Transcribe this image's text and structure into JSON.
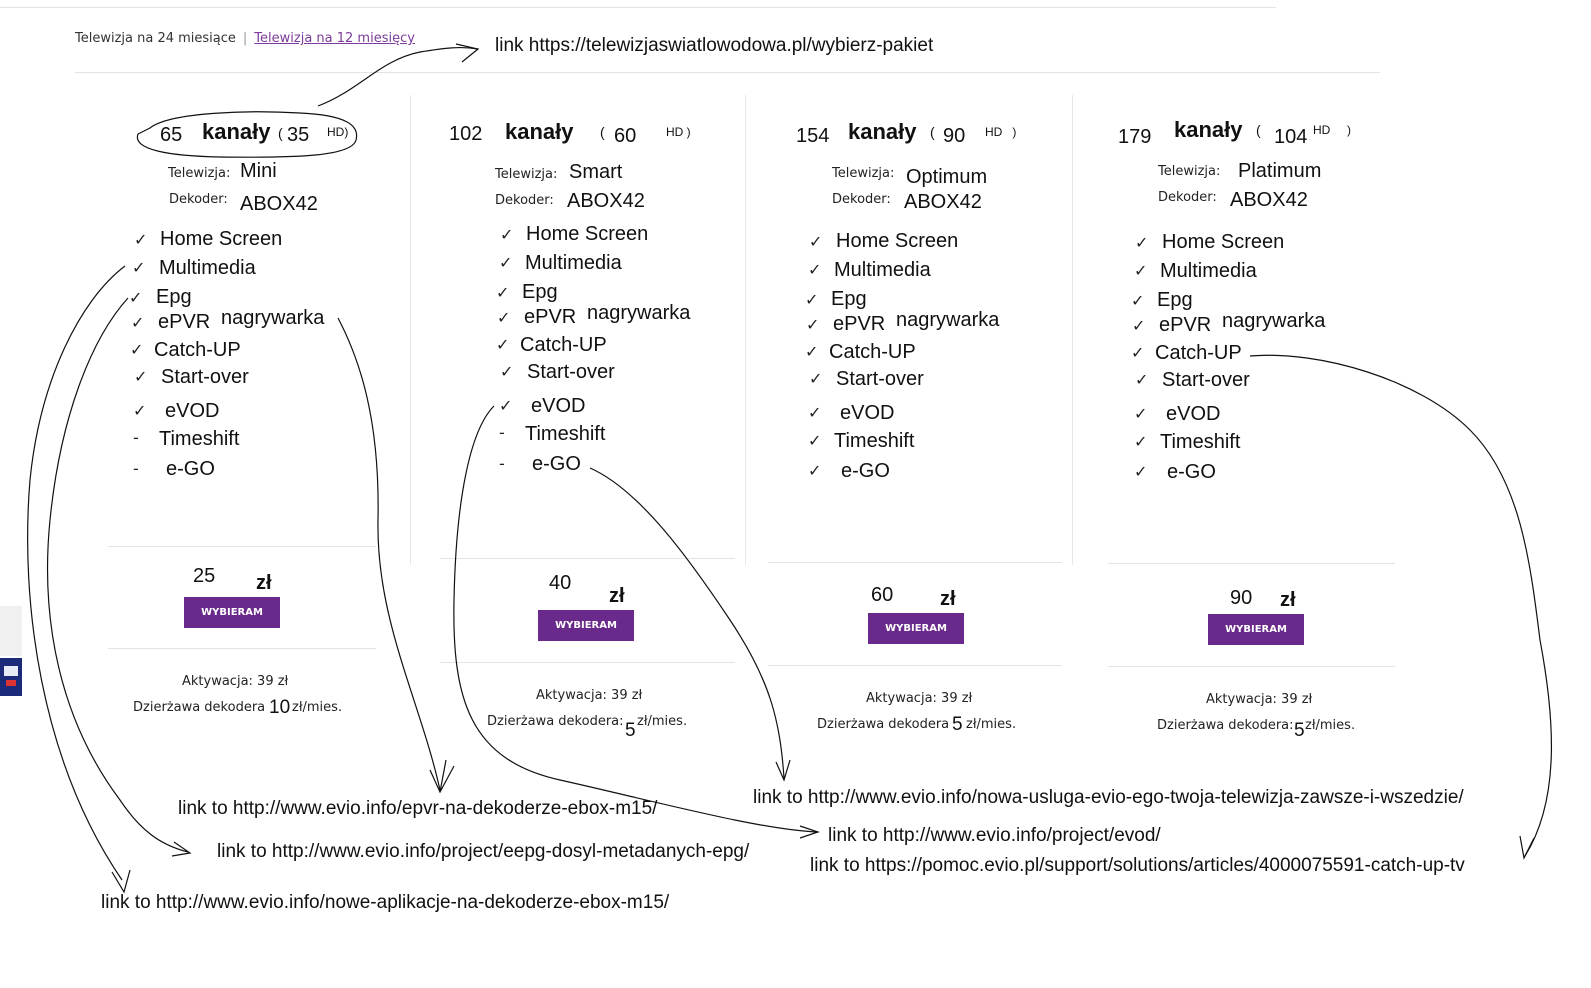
{
  "tabs": {
    "active": "Telewizja na 24 miesiące",
    "separator": "|",
    "link": "Telewizja na 12 miesięcy"
  },
  "labels": {
    "telewizja": "Telewizja:",
    "dekoder": "Dekoder:",
    "kanaly": "kanały",
    "hd": "HD)",
    "zl": "zł",
    "button": "WYBIERAM",
    "aktywacja": "Aktywacja: 39 zł",
    "dzierzawa": "Dzierżawa dekodera",
    "per_month": "zł/mies.",
    "check": "✓",
    "dash": "-"
  },
  "packages": [
    {
      "channels": "65",
      "hd": "35",
      "tv": "Mini",
      "decoder": "ABOX42",
      "price": "25",
      "rental": "10",
      "features": [
        "Home Screen",
        "Multimedia",
        "Epg",
        "ePVR",
        "Catch-UP",
        "Start-over",
        "eVOD",
        "Timeshift",
        "e-GO"
      ],
      "nagrywarka": "nagrywarka",
      "marks": [
        "check",
        "check",
        "check",
        "check",
        "check",
        "check",
        "check",
        "dash",
        "dash"
      ]
    },
    {
      "channels": "102",
      "hd": "60",
      "tv": "Smart",
      "decoder": "ABOX42",
      "price": "40",
      "rental": "5",
      "features": [
        "Home Screen",
        "Multimedia",
        "Epg",
        "ePVR",
        "Catch-UP",
        "Start-over",
        "eVOD",
        "Timeshift",
        "e-GO"
      ],
      "nagrywarka": "nagrywarka",
      "marks": [
        "check",
        "check",
        "check",
        "check",
        "check",
        "check",
        "check",
        "dash",
        "dash"
      ]
    },
    {
      "channels": "154",
      "hd": "90",
      "tv": "Optimum",
      "decoder": "ABOX42",
      "price": "60",
      "rental": "5",
      "features": [
        "Home Screen",
        "Multimedia",
        "Epg",
        "ePVR",
        "Catch-UP",
        "Start-over",
        "eVOD",
        "Timeshift",
        "e-GO"
      ],
      "nagrywarka": "nagrywarka",
      "marks": [
        "check",
        "check",
        "check",
        "check",
        "check",
        "check",
        "check",
        "check",
        "check"
      ]
    },
    {
      "channels": "179",
      "hd": "104",
      "tv": "Platimum",
      "decoder": "ABOX42",
      "price": "90",
      "rental": "5",
      "features": [
        "Home Screen",
        "Multimedia",
        "Epg",
        "ePVR",
        "Catch-UP",
        "Start-over",
        "eVOD",
        "Timeshift",
        "e-GO"
      ],
      "nagrywarka": "nagrywarka",
      "marks": [
        "check",
        "check",
        "check",
        "check",
        "check",
        "check",
        "check",
        "check",
        "check"
      ]
    }
  ],
  "annotations": {
    "top": "link https://telewizjaswiatlowodowa.pl/wybierz-pakiet",
    "epvr": "link to http://www.evio.info/epvr-na-dekoderze-ebox-m15/",
    "epg": "link to http://www.evio.info/project/eepg-dosyl-metadanych-epg/",
    "multimedia": "link to http://www.evio.info/nowe-aplikacje-na-dekoderze-ebox-m15/",
    "ego": "link to http://www.evio.info/nowa-usluga-evio-ego-twoja-telewizja-zawsze-i-wszedzie/",
    "evod": "link to http://www.evio.info/project/evod/",
    "catchup": "link to https://pomoc.evio.pl/support/solutions/articles/4000075591-catch-up-tv"
  }
}
